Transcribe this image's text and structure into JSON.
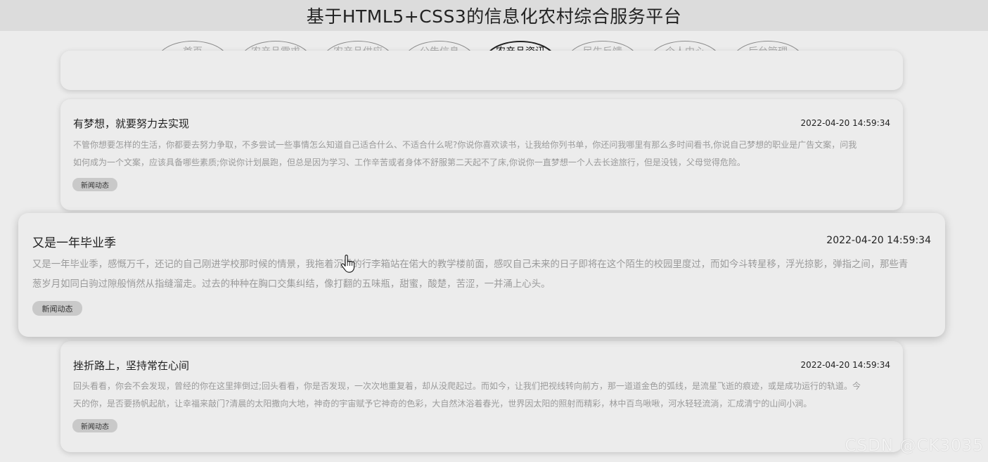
{
  "header": {
    "title": "基于HTML5+CSS3的信息化农村综合服务平台"
  },
  "nav": {
    "tabs": [
      {
        "label": "首页",
        "active": false
      },
      {
        "label": "农产品需求",
        "active": false
      },
      {
        "label": "农产品供应",
        "active": false
      },
      {
        "label": "公告信息",
        "active": false
      },
      {
        "label": "农产品资讯",
        "active": true
      },
      {
        "label": "民生反馈",
        "active": false
      },
      {
        "label": "个人中心",
        "active": false
      },
      {
        "label": "后台管理",
        "active": false
      }
    ]
  },
  "articles": [
    {
      "title": "有梦想，就要努力去实现",
      "date": "2022-04-20 14:59:34",
      "body_line1": "不管你想要怎样的生活，你都要去努力争取，不多尝试一些事情怎么知道自己适合什么、不适合什么呢?你说你喜欢读书，让我给你列书单，你还问我哪里有那么多时间看书,你说自己梦想的职业是广告文案，问我",
      "body_line2": "如何成为一个文案，应该具备哪些素质;你说你计划晨跑，但总是因为学习、工作辛苦或者身体不舒服第二天起不了床,你说你一直梦想一个人去长途旅行，但是没钱，父母觉得危险。",
      "tag": "新闻动态"
    },
    {
      "title": "又是一年毕业季",
      "date": "2022-04-20 14:59:34",
      "body_line1": "又是一年毕业季，感慨万千，还记的自己刚进学校那时候的情景，我拖着沉重的行李箱站在偌大的教学楼前面，感叹自己未来的日子即将在这个陌生的校园里度过，而如今斗转星移，浮光掠影，弹指之间，那些青",
      "body_line2": "葱岁月如同白驹过隙般悄然从指缝溜走。过去的种种在胸口交集纠结，像打翻的五味瓶，甜蜜，酸楚，苦涩，一并涌上心头。",
      "tag": "新闻动态"
    },
    {
      "title": "挫折路上，坚持常在心间",
      "date": "2022-04-20 14:59:34",
      "body_line1": "回头看看，你会不会发现，曾经的你在这里摔倒过;回头看看，你是否发现，一次次地重复着，却从没爬起过。而如今，让我们把视线转向前方，那一道道金色的弧线，是流星飞逝的痕迹，或是成功运行的轨道。今",
      "body_line2": "天的你，是否要扬帆起航，让幸福来敲门?清晨的太阳撒向大地，神奇的宇宙赋予它神奇的色彩，大自然沐浴着春光，世界因太阳的照射而精彩，林中百鸟啾啾，河水轻轻流淌，汇成清宁的山间小涧。",
      "tag": "新闻动态"
    }
  ],
  "watermark": "CSDN @CK3035",
  "icons": {
    "cursor": "hand-pointer-icon"
  }
}
